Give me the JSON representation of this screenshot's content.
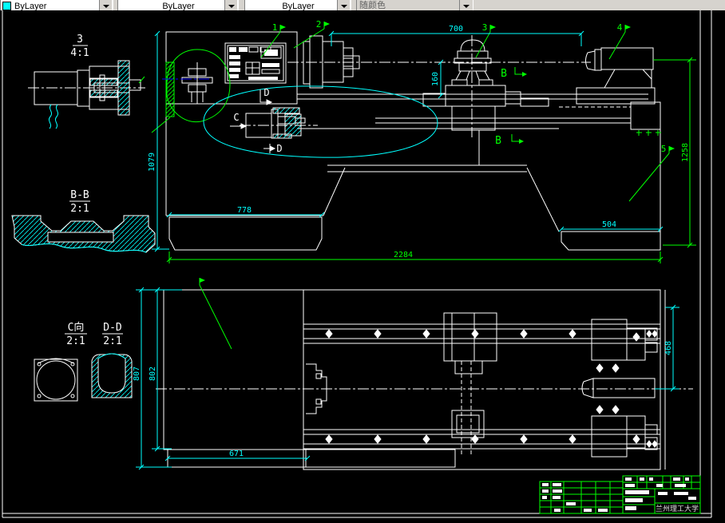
{
  "toolbar": {
    "color_value": "ByLayer",
    "linetype_value": "ByLayer",
    "lineweight_value": "ByLayer",
    "plot_style_value": "随颜色",
    "swatch_color": "#00ffff"
  },
  "views": {
    "detail_3": {
      "label": "3",
      "scale": "4:1"
    },
    "section_bb": {
      "label": "B-B",
      "scale": "2:1"
    },
    "view_c": {
      "label": "C向",
      "scale": "2:1"
    },
    "section_dd": {
      "label": "D-D",
      "scale": "2:1"
    }
  },
  "front_view": {
    "dim_700": "700",
    "dim_160": "160",
    "dim_1079": "1079",
    "dim_1258": "1258",
    "dim_778": "778",
    "dim_504": "504",
    "dim_2284": "2284",
    "balloon_1": "1",
    "balloon_2": "2",
    "balloon_3": "3",
    "balloon_4": "4",
    "balloon_5": "5",
    "marker_b_upper": "B",
    "marker_b_lower": "B",
    "marker_c": "C",
    "marker_d_upper": "D",
    "marker_d_lower": "D"
  },
  "plan_view": {
    "dim_807": "807",
    "dim_802": "802",
    "dim_671": "671",
    "dim_468": "468"
  },
  "title_block": {
    "company": "兰州理工大学"
  },
  "colors": {
    "line": "#ffffff",
    "dimension": "#00ffff",
    "annotation": "#00ff00",
    "centerline_blue": "#0000ff",
    "background": "#000000"
  }
}
